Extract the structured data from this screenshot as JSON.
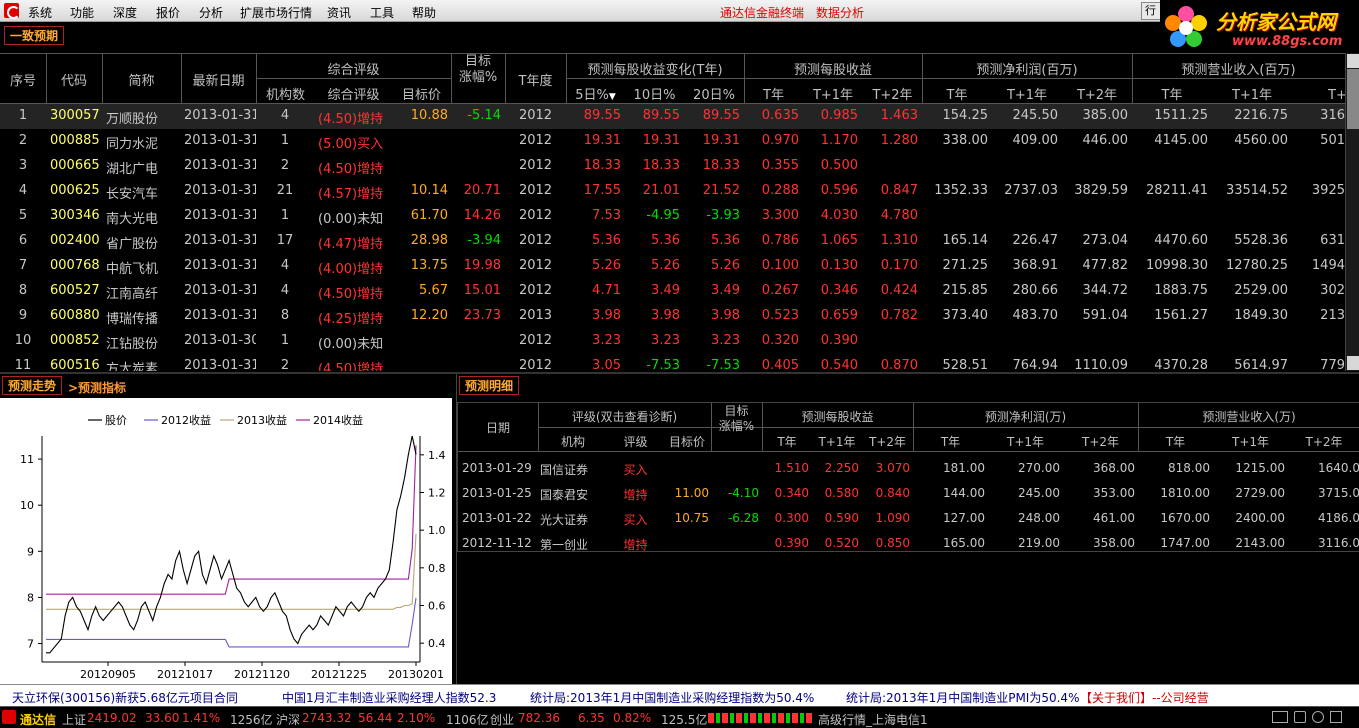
{
  "menu": {
    "items": [
      "系统",
      "功能",
      "深度",
      "报价",
      "分析",
      "扩展市场行情",
      "资讯",
      "工具",
      "帮助"
    ],
    "promo1": "通达信金融终端",
    "promo2": "数据分析",
    "partial_button": "行"
  },
  "logo": {
    "text": "分析家公式网",
    "url": "www.88gs.com"
  },
  "top_tab": "一致预期",
  "table": {
    "headers": {
      "seq": "序号",
      "code": "代码",
      "name": "简称",
      "date": "最新日期",
      "rating_group": "综合评级",
      "org_count": "机构数",
      "rating": "综合评级",
      "target_price": "目标价",
      "target_up": "目标\n涨幅%",
      "year": "T年度",
      "eps_change_group": "预测每股收益变化(T年)",
      "d5": "5日%",
      "d10": "10日%",
      "d20": "20日%",
      "eps_group": "预测每股收益",
      "t": "T年",
      "t1": "T+1年",
      "t2": "T+2年",
      "profit_group": "预测净利润(百万)",
      "rev_group": "预测营业收入(百万)"
    },
    "rows": [
      {
        "seq": "1",
        "code": "300057",
        "name": "万顺股份",
        "date": "2013-01-31",
        "orgs": "4",
        "rating": "(4.50)增持",
        "tp": "10.88",
        "up": "-5.14",
        "year": "2012",
        "d5": "89.55",
        "d10": "89.55",
        "d20": "89.55",
        "e0": "0.635",
        "e1": "0.985",
        "e2": "1.463",
        "p0": "154.25",
        "p1": "245.50",
        "p2": "385.00",
        "v0": "1511.25",
        "v1": "2216.75",
        "v2": "316"
      },
      {
        "seq": "2",
        "code": "000885",
        "name": "同力水泥",
        "date": "2013-01-31",
        "orgs": "1",
        "rating": "(5.00)买入",
        "tp": "",
        "up": "",
        "year": "2012",
        "d5": "19.31",
        "d10": "19.31",
        "d20": "19.31",
        "e0": "0.970",
        "e1": "1.170",
        "e2": "1.280",
        "p0": "338.00",
        "p1": "409.00",
        "p2": "446.00",
        "v0": "4145.00",
        "v1": "4560.00",
        "v2": "501"
      },
      {
        "seq": "3",
        "code": "000665",
        "name": "湖北广电",
        "date": "2013-01-31",
        "orgs": "2",
        "rating": "(4.50)增持",
        "tp": "",
        "up": "",
        "year": "2012",
        "d5": "18.33",
        "d10": "18.33",
        "d20": "18.33",
        "e0": "0.355",
        "e1": "0.500",
        "e2": "",
        "p0": "",
        "p1": "",
        "p2": "",
        "v0": "",
        "v1": "",
        "v2": ""
      },
      {
        "seq": "4",
        "code": "000625",
        "name": "长安汽车",
        "date": "2013-01-31",
        "orgs": "21",
        "rating": "(4.57)增持",
        "tp": "10.14",
        "up": "20.71",
        "year": "2012",
        "d5": "17.55",
        "d10": "21.01",
        "d20": "21.52",
        "e0": "0.288",
        "e1": "0.596",
        "e2": "0.847",
        "p0": "1352.33",
        "p1": "2737.03",
        "p2": "3829.59",
        "v0": "28211.41",
        "v1": "33514.52",
        "v2": "3925"
      },
      {
        "seq": "5",
        "code": "300346",
        "name": "南大光电",
        "date": "2013-01-31",
        "orgs": "1",
        "rating": "(0.00)未知",
        "tp": "61.70",
        "up": "14.26",
        "year": "2012",
        "d5": "7.53",
        "d10": "-4.95",
        "d20": "-3.93",
        "e0": "3.300",
        "e1": "4.030",
        "e2": "4.780",
        "p0": "",
        "p1": "",
        "p2": "",
        "v0": "",
        "v1": "",
        "v2": ""
      },
      {
        "seq": "6",
        "code": "002400",
        "name": "省广股份",
        "date": "2013-01-31",
        "orgs": "17",
        "rating": "(4.47)增持",
        "tp": "28.98",
        "up": "-3.94",
        "year": "2012",
        "d5": "5.36",
        "d10": "5.36",
        "d20": "5.36",
        "e0": "0.786",
        "e1": "1.065",
        "e2": "1.310",
        "p0": "165.14",
        "p1": "226.47",
        "p2": "273.04",
        "v0": "4470.60",
        "v1": "5528.36",
        "v2": "631"
      },
      {
        "seq": "7",
        "code": "000768",
        "name": "中航飞机",
        "date": "2013-01-31",
        "orgs": "4",
        "rating": "(4.00)增持",
        "tp": "13.75",
        "up": "19.98",
        "year": "2012",
        "d5": "5.26",
        "d10": "5.26",
        "d20": "5.26",
        "e0": "0.100",
        "e1": "0.130",
        "e2": "0.170",
        "p0": "271.25",
        "p1": "368.91",
        "p2": "477.82",
        "v0": "10998.30",
        "v1": "12780.25",
        "v2": "1494"
      },
      {
        "seq": "8",
        "code": "600527",
        "name": "江南高纤",
        "date": "2013-01-31",
        "orgs": "4",
        "rating": "(4.50)增持",
        "tp": "5.67",
        "up": "15.01",
        "year": "2012",
        "d5": "4.71",
        "d10": "3.49",
        "d20": "3.49",
        "e0": "0.267",
        "e1": "0.346",
        "e2": "0.424",
        "p0": "215.85",
        "p1": "280.66",
        "p2": "344.72",
        "v0": "1883.75",
        "v1": "2529.00",
        "v2": "302"
      },
      {
        "seq": "9",
        "code": "600880",
        "name": "博瑞传播",
        "date": "2013-01-31",
        "orgs": "8",
        "rating": "(4.25)增持",
        "tp": "12.20",
        "up": "23.73",
        "year": "2013",
        "d5": "3.98",
        "d10": "3.98",
        "d20": "3.98",
        "e0": "0.523",
        "e1": "0.659",
        "e2": "0.782",
        "p0": "373.40",
        "p1": "483.70",
        "p2": "591.04",
        "v0": "1561.27",
        "v1": "1849.30",
        "v2": "213"
      },
      {
        "seq": "10",
        "code": "000852",
        "name": "江钻股份",
        "date": "2013-01-30",
        "orgs": "1",
        "rating": "(0.00)未知",
        "tp": "",
        "up": "",
        "year": "2012",
        "d5": "3.23",
        "d10": "3.23",
        "d20": "3.23",
        "e0": "0.320",
        "e1": "0.390",
        "e2": "",
        "p0": "",
        "p1": "",
        "p2": "",
        "v0": "",
        "v1": "",
        "v2": ""
      },
      {
        "seq": "11",
        "code": "600516",
        "name": "方大炭素",
        "date": "2013-01-31",
        "orgs": "2",
        "rating": "(4.50)增持",
        "tp": "",
        "up": "",
        "year": "2012",
        "d5": "3.05",
        "d10": "-7.53",
        "d20": "-7.53",
        "e0": "0.405",
        "e1": "0.540",
        "e2": "0.870",
        "p0": "528.51",
        "p1": "764.94",
        "p2": "1110.09",
        "v0": "4370.28",
        "v1": "5614.97",
        "v2": "779"
      }
    ]
  },
  "chart_tabs": {
    "tab1": "预测走势",
    "tab2": ">预测指标"
  },
  "detail_tab": "预测明细",
  "detail": {
    "headers": {
      "date": "日期",
      "rating_group": "评级(双击查看诊断)",
      "org": "机构",
      "rating": "评级",
      "tp": "目标价",
      "up": "目标\n涨幅%",
      "eps_group": "预测每股收益",
      "profit_group": "预测净利润(万)",
      "rev_group": "预测营业收入(万)",
      "t": "T年",
      "t1": "T+1年",
      "t2": "T+2年"
    },
    "rows": [
      {
        "date": "2013-01-29",
        "org": "国信证券",
        "rating": "买入",
        "tp": "",
        "up": "",
        "e0": "1.510",
        "e1": "2.250",
        "e2": "3.070",
        "p0": "181.00",
        "p1": "270.00",
        "p2": "368.00",
        "v0": "818.00",
        "v1": "1215.00",
        "v2": "1640.0"
      },
      {
        "date": "2013-01-25",
        "org": "国泰君安",
        "rating": "增持",
        "tp": "11.00",
        "up": "-4.10",
        "e0": "0.340",
        "e1": "0.580",
        "e2": "0.840",
        "p0": "144.00",
        "p1": "245.00",
        "p2": "353.00",
        "v0": "1810.00",
        "v1": "2729.00",
        "v2": "3715.0"
      },
      {
        "date": "2013-01-22",
        "org": "光大证券",
        "rating": "买入",
        "tp": "10.75",
        "up": "-6.28",
        "e0": "0.300",
        "e1": "0.590",
        "e2": "1.090",
        "p0": "127.00",
        "p1": "248.00",
        "p2": "461.00",
        "v0": "1670.00",
        "v1": "2400.00",
        "v2": "4186.0"
      },
      {
        "date": "2012-11-12",
        "org": "第一创业",
        "rating": "增持",
        "tp": "",
        "up": "",
        "e0": "0.390",
        "e1": "0.520",
        "e2": "0.850",
        "p0": "165.00",
        "p1": "219.00",
        "p2": "358.00",
        "v0": "1747.00",
        "v1": "2143.00",
        "v2": "3116.0"
      }
    ]
  },
  "chart_data": {
    "type": "line",
    "legend": [
      "股价",
      "2012收益",
      "2013收益",
      "2014收益"
    ],
    "x_ticks": [
      "20120905",
      "20121017",
      "20121120",
      "20121225",
      "20130201"
    ],
    "y_left_ticks": [
      "7",
      "8",
      "9",
      "10",
      "11"
    ],
    "y_right_ticks": [
      "0.4",
      "0.6",
      "0.8",
      "1.0",
      "1.2",
      "1.4"
    ],
    "y_left_range": [
      6.6,
      11.5
    ],
    "y_right_range": [
      0.3,
      1.5
    ],
    "colors": {
      "price": "#000000",
      "e2012": "#6a5acd",
      "e2013": "#b8a878",
      "e2014": "#a020a0"
    },
    "price": [
      6.8,
      6.8,
      6.9,
      7.0,
      7.1,
      7.6,
      7.9,
      8.0,
      7.8,
      7.7,
      7.5,
      7.3,
      7.6,
      7.8,
      7.6,
      7.5,
      7.6,
      7.7,
      7.8,
      7.9,
      7.8,
      7.6,
      7.4,
      7.3,
      7.5,
      7.8,
      7.9,
      7.7,
      7.5,
      7.8,
      8.0,
      8.3,
      8.5,
      8.4,
      8.8,
      9.0,
      8.6,
      8.3,
      8.6,
      8.9,
      9.0,
      8.5,
      8.3,
      8.6,
      8.9,
      8.7,
      8.4,
      8.6,
      8.8,
      8.5,
      8.2,
      8.1,
      7.9,
      7.8,
      7.9,
      8.0,
      7.8,
      7.7,
      7.8,
      8.0,
      8.1,
      7.9,
      7.7,
      7.6,
      7.3,
      7.1,
      7.0,
      7.2,
      7.3,
      7.4,
      7.3,
      7.4,
      7.6,
      7.5,
      7.4,
      7.6,
      7.8,
      7.7,
      7.6,
      7.8,
      7.9,
      7.8,
      7.7,
      7.8,
      8.0,
      8.1,
      8.0,
      8.2,
      8.3,
      8.4,
      8.6,
      9.2,
      9.9,
      10.2,
      10.6,
      11.1,
      11.5,
      11.1
    ],
    "e2012": [
      0.42,
      0.42,
      0.42,
      0.42,
      0.42,
      0.42,
      0.42,
      0.42,
      0.42,
      0.42,
      0.42,
      0.42,
      0.42,
      0.42,
      0.42,
      0.42,
      0.42,
      0.42,
      0.42,
      0.42,
      0.42,
      0.42,
      0.42,
      0.42,
      0.42,
      0.42,
      0.42,
      0.42,
      0.42,
      0.42,
      0.42,
      0.42,
      0.42,
      0.42,
      0.42,
      0.42,
      0.42,
      0.42,
      0.42,
      0.42,
      0.42,
      0.42,
      0.42,
      0.42,
      0.42,
      0.42,
      0.42,
      0.42,
      0.38,
      0.38,
      0.38,
      0.38,
      0.38,
      0.38,
      0.38,
      0.38,
      0.38,
      0.38,
      0.38,
      0.38,
      0.38,
      0.38,
      0.38,
      0.38,
      0.38,
      0.38,
      0.38,
      0.38,
      0.38,
      0.38,
      0.38,
      0.38,
      0.38,
      0.38,
      0.38,
      0.38,
      0.38,
      0.38,
      0.38,
      0.38,
      0.38,
      0.38,
      0.38,
      0.38,
      0.38,
      0.38,
      0.38,
      0.38,
      0.38,
      0.38,
      0.38,
      0.38,
      0.38,
      0.38,
      0.38,
      0.38,
      0.5,
      0.64
    ],
    "e2013": [
      0.58,
      0.58,
      0.58,
      0.58,
      0.58,
      0.58,
      0.58,
      0.58,
      0.58,
      0.58,
      0.58,
      0.58,
      0.58,
      0.58,
      0.58,
      0.58,
      0.58,
      0.58,
      0.58,
      0.58,
      0.58,
      0.58,
      0.58,
      0.58,
      0.58,
      0.58,
      0.58,
      0.58,
      0.58,
      0.58,
      0.58,
      0.58,
      0.58,
      0.58,
      0.58,
      0.58,
      0.58,
      0.58,
      0.58,
      0.58,
      0.58,
      0.58,
      0.58,
      0.58,
      0.58,
      0.58,
      0.58,
      0.58,
      0.58,
      0.58,
      0.58,
      0.58,
      0.58,
      0.58,
      0.58,
      0.58,
      0.58,
      0.58,
      0.58,
      0.58,
      0.58,
      0.58,
      0.58,
      0.58,
      0.58,
      0.58,
      0.58,
      0.58,
      0.58,
      0.58,
      0.58,
      0.58,
      0.58,
      0.58,
      0.58,
      0.58,
      0.58,
      0.58,
      0.58,
      0.58,
      0.58,
      0.58,
      0.58,
      0.58,
      0.58,
      0.58,
      0.58,
      0.58,
      0.58,
      0.58,
      0.58,
      0.58,
      0.59,
      0.59,
      0.6,
      0.6,
      0.61,
      0.98
    ],
    "e2014": [
      0.66,
      0.66,
      0.66,
      0.66,
      0.66,
      0.66,
      0.66,
      0.66,
      0.66,
      0.66,
      0.66,
      0.66,
      0.66,
      0.66,
      0.66,
      0.66,
      0.66,
      0.66,
      0.66,
      0.66,
      0.66,
      0.66,
      0.66,
      0.66,
      0.66,
      0.66,
      0.66,
      0.66,
      0.66,
      0.66,
      0.66,
      0.66,
      0.66,
      0.66,
      0.66,
      0.66,
      0.66,
      0.66,
      0.66,
      0.66,
      0.66,
      0.66,
      0.66,
      0.66,
      0.66,
      0.66,
      0.66,
      0.66,
      0.74,
      0.74,
      0.74,
      0.74,
      0.74,
      0.74,
      0.74,
      0.74,
      0.74,
      0.74,
      0.74,
      0.74,
      0.74,
      0.74,
      0.74,
      0.74,
      0.74,
      0.74,
      0.74,
      0.74,
      0.74,
      0.74,
      0.74,
      0.74,
      0.74,
      0.74,
      0.74,
      0.74,
      0.74,
      0.74,
      0.74,
      0.74,
      0.74,
      0.74,
      0.74,
      0.74,
      0.74,
      0.74,
      0.74,
      0.74,
      0.74,
      0.74,
      0.74,
      0.74,
      0.74,
      0.74,
      0.74,
      0.74,
      0.9,
      1.45
    ]
  },
  "news": [
    "天立环保(300156)新获5.68亿元项目合同",
    "中国1月汇丰制造业采购经理人指数52.3",
    "统计局:2013年1月中国制造业采购经理指数为50.4%",
    "统计局:2013年1月中国制造业PMI为50.4%",
    "【关于我们】--公司经营"
  ],
  "status": {
    "brand": "通达信",
    "sh_label": "上证",
    "sh_val": "2419.02",
    "sh_chg": "33.60",
    "sh_pct": "1.41%",
    "sh_vol": "1256亿",
    "sz_label": "沪深",
    "sz_val": "2743.32",
    "sz_chg": "56.44",
    "sz_pct": "2.10%",
    "sz_vol": "1106亿",
    "cy_label": "创业",
    "cy_val": "782.36",
    "cy_chg": "6.35",
    "cy_pct": "0.82%",
    "cy_vol": "125.5亿",
    "server": "高级行情_上海电信1"
  }
}
